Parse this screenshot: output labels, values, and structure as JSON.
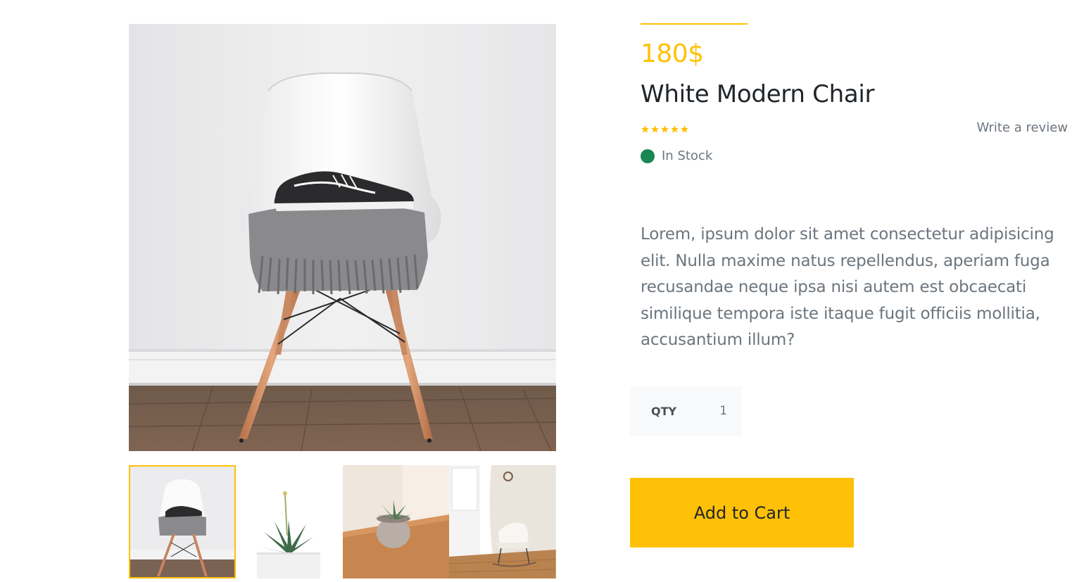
{
  "product": {
    "price": "180$",
    "title": "White Modern Chair",
    "rating": 5,
    "review_link": "Write a review",
    "stock_status": "In Stock",
    "description": "Lorem, ipsum dolor sit amet consectetur adipisicing elit. Nulla maxime natus repellendus, aperiam fuga recusandae neque ipsa nisi autem est obcaecati similique tempora iste itaque fugit officiis mollitia, accusantium illum?",
    "qty_label": "QTY",
    "qty_value": "1",
    "add_to_cart_label": "Add to Cart"
  },
  "gallery": {
    "main_image": "white-chair-with-sneakers",
    "thumbnails": [
      {
        "name": "white-chair-with-sneakers",
        "active": true
      },
      {
        "name": "aloe-plant-in-white-pot",
        "active": false
      },
      {
        "name": "succulent-on-wooden-table",
        "active": false
      },
      {
        "name": "rocking-chair-in-corner",
        "active": false
      }
    ]
  },
  "colors": {
    "accent": "#ffc107",
    "stock_green": "#198754",
    "text_muted": "#6c757d",
    "text_dark": "#212529"
  }
}
